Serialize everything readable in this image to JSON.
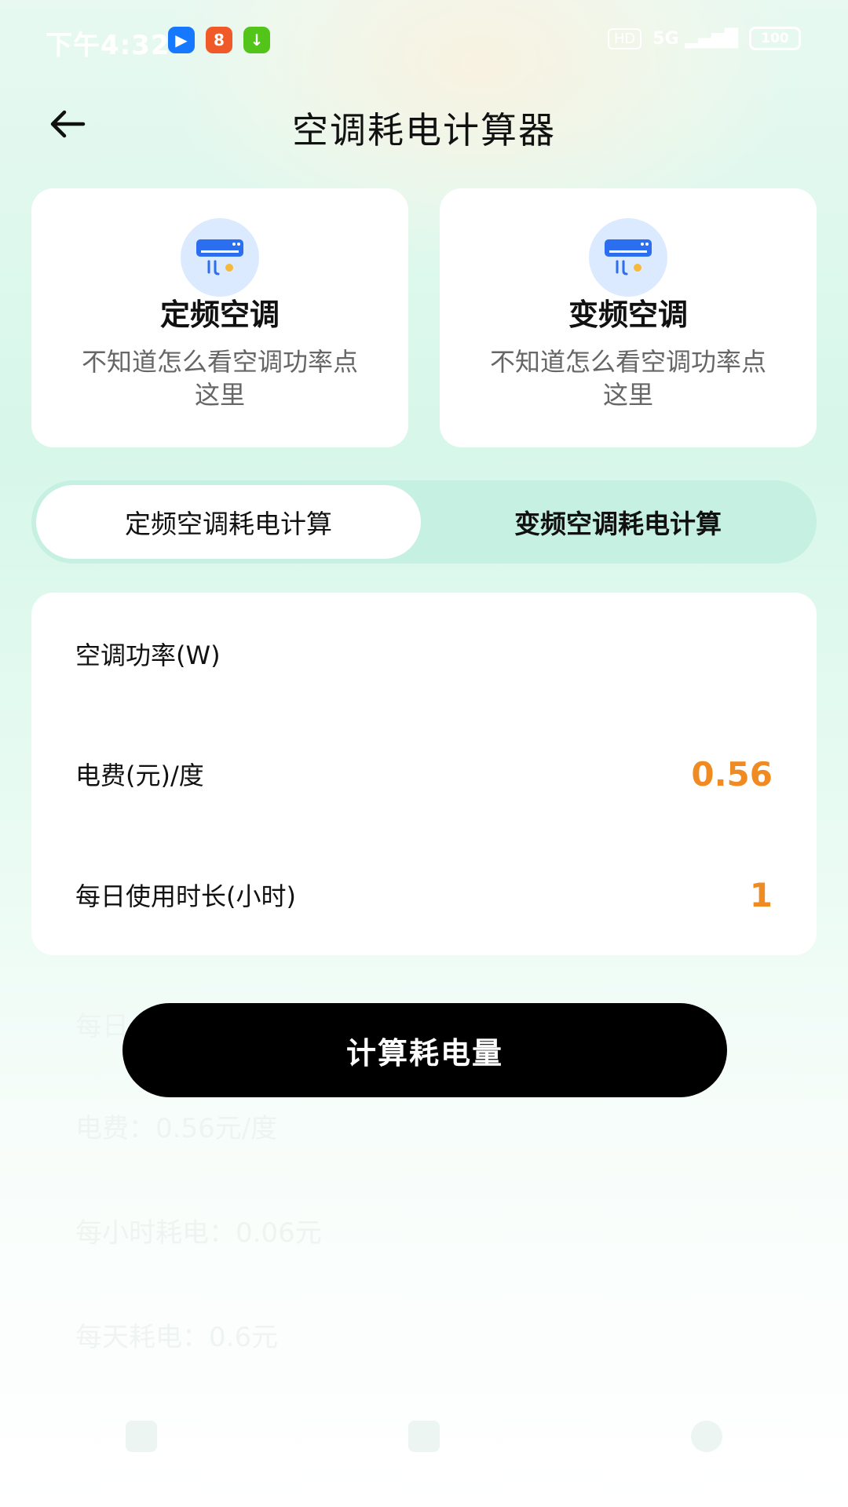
{
  "status_bar": {
    "time": "下午4:32",
    "apps": [
      {
        "icon": "blue-app-icon",
        "color": "#1677ff",
        "glyph": "▶"
      },
      {
        "icon": "orange-app-icon",
        "color": "#f05a28",
        "glyph": "8"
      },
      {
        "icon": "green-download-icon",
        "color": "#52c41a",
        "glyph": "↓"
      }
    ],
    "hd_label": "HD",
    "network": "5G",
    "battery": "100"
  },
  "header": {
    "back_icon": "arrow-left-icon",
    "title": "空调耗电计算器"
  },
  "type_cards": [
    {
      "icon": "air-conditioner-icon",
      "name": "定频空调",
      "desc": "不知道怎么看空调功率点这里"
    },
    {
      "icon": "air-conditioner-icon",
      "name": "变频空调",
      "desc": "不知道怎么看空调功率点这里"
    }
  ],
  "tabs": [
    {
      "label": "定频空调耗电计算",
      "active": true
    },
    {
      "label": "变频空调耗电计算",
      "active": false
    }
  ],
  "form": {
    "power_label": "空调功率(W)",
    "power_value": "",
    "price_label": "电费(元)/度",
    "price_value": "0.56",
    "hours_label": "每日使用时长(小时)",
    "hours_value": "1"
  },
  "calculate_button": "计算耗电量",
  "faded_results": {
    "line1": "每日",
    "line2": "电费：0.56元/度",
    "line2_right": "",
    "line3": "每小时耗电：0.06元",
    "line3_right": "",
    "line4": "每天耗电：0.6元"
  },
  "bottom_nav": [
    {
      "icon": "home-icon",
      "label": ""
    },
    {
      "icon": "document-icon",
      "label": ""
    },
    {
      "icon": "user-icon",
      "label": ""
    }
  ],
  "colors": {
    "accent_orange": "#f08a22",
    "tab_bg": "#c6f0e2",
    "button_bg": "#000000"
  }
}
